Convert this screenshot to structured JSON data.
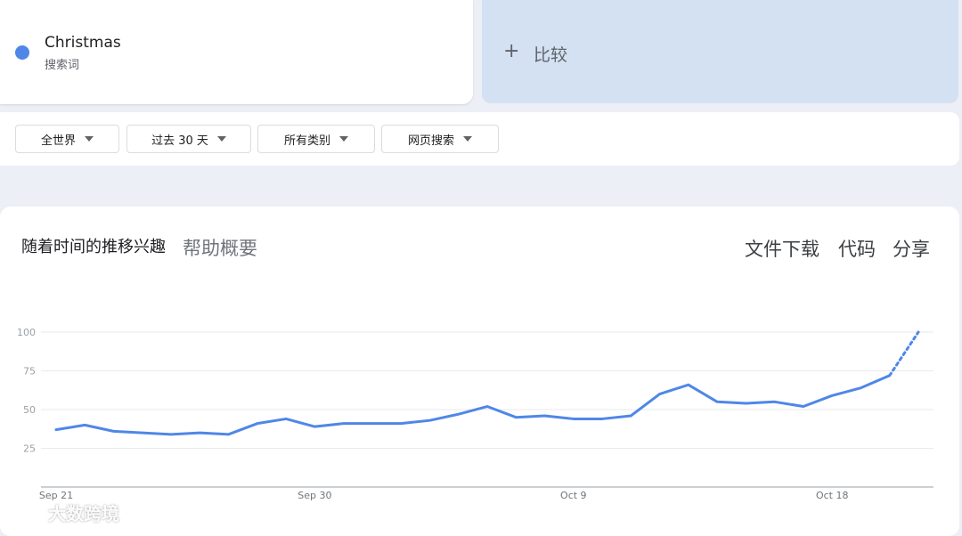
{
  "term": {
    "name": "Christmas",
    "type": "搜索词",
    "color": "#4f87e8"
  },
  "compare": {
    "icon": "plus-icon",
    "label": "比较"
  },
  "filters": [
    {
      "label": "全世界",
      "icon": "caret-down-icon"
    },
    {
      "label": "过去 30 天",
      "icon": "caret-down-icon"
    },
    {
      "label": "所有类别",
      "icon": "caret-down-icon"
    },
    {
      "label": "网页搜索",
      "icon": "caret-down-icon"
    }
  ],
  "chart": {
    "title": "随着时间的推移兴趣",
    "help": "帮助概要",
    "actions": [
      "文件下载",
      "代码",
      "分享"
    ]
  },
  "chart_data": {
    "type": "line",
    "title": "",
    "xlabel": "",
    "ylabel": "",
    "y_ticks": [
      25,
      50,
      75,
      100
    ],
    "x_tick_labels": [
      {
        "label": "Sep 21",
        "index": 0
      },
      {
        "label": "Sep 30",
        "index": 9
      },
      {
        "label": "Oct 9",
        "index": 18
      },
      {
        "label": "Oct 18",
        "index": 27
      }
    ],
    "grid": true,
    "series": [
      {
        "values": [
          37,
          40,
          36,
          35,
          34,
          35,
          34,
          41,
          44,
          39,
          41,
          41,
          41,
          43,
          47,
          52,
          45,
          46,
          44,
          44,
          46,
          60,
          66,
          55,
          54,
          55,
          52,
          59,
          64,
          72,
          100
        ],
        "partial_from_index": 29,
        "color": "#4f87e8"
      }
    ]
  },
  "watermark": "大数跨境"
}
